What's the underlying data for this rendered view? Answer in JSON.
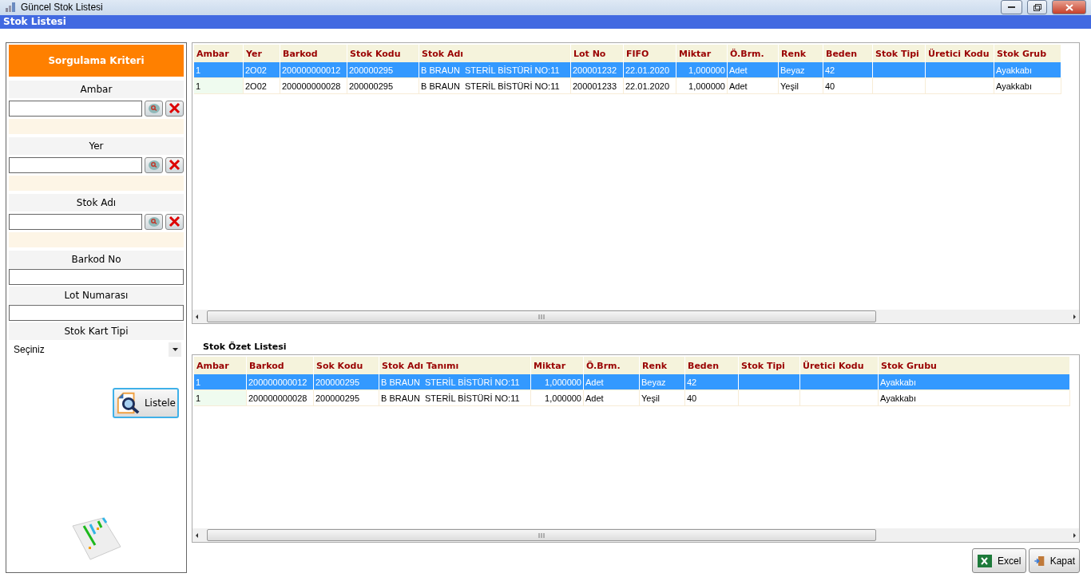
{
  "window": {
    "title": "Güncel Stok Listesi"
  },
  "header_bar": {
    "title": "Stok Listesi"
  },
  "filter_panel": {
    "title": "Sorgulama Kriteri",
    "lookups": [
      {
        "label": "Ambar"
      },
      {
        "label": "Yer"
      },
      {
        "label": "Stok Adı"
      }
    ],
    "text_fields": [
      {
        "label": "Barkod No"
      },
      {
        "label": "Lot Numarası"
      }
    ],
    "dropdown": {
      "label": "Stok Kart Tipi",
      "value": "Seçiniz"
    },
    "list_button": "Listele"
  },
  "stock_grid": {
    "columns": [
      "Ambar",
      "Yer",
      "Barkod",
      "Stok Kodu",
      "Stok Adı",
      "Lot No",
      "FIFO",
      "Miktar",
      "Ö.Brm.",
      "Renk",
      "Beden",
      "Stok Tipi",
      "Üretici Kodu",
      "Stok Grub"
    ],
    "rows": [
      {
        "selected": true,
        "cells": [
          "1",
          "2O02",
          "200000000012",
          "200000295",
          "B BRAUN  STERİL BİSTÜRİ NO:11",
          "200001232",
          "22.01.2020",
          "1,000000",
          "Adet",
          "Beyaz",
          "42",
          "",
          "",
          "Ayakkabı"
        ]
      },
      {
        "selected": false,
        "cells": [
          "1",
          "2O02",
          "200000000028",
          "200000295",
          "B BRAUN  STERİL BİSTÜRİ NO:11",
          "200001233",
          "22.01.2020",
          "1,000000",
          "Adet",
          "Yeşil",
          "40",
          "",
          "",
          "Ayakkabı"
        ]
      }
    ]
  },
  "summary_grid": {
    "title": "Stok Özet Listesi",
    "columns": [
      "Ambar",
      "Barkod",
      "Sok Kodu",
      "Stok Adı Tanımı",
      "Miktar",
      "Ö.Brm.",
      "Renk",
      "Beden",
      "Stok Tipi",
      "Üretici Kodu",
      "Stok Grubu"
    ],
    "rows": [
      {
        "selected": true,
        "cells": [
          "1",
          "200000000012",
          "200000295",
          "B BRAUN  STERİL BİSTÜRİ NO:11",
          "1,000000",
          "Adet",
          "Beyaz",
          "42",
          "",
          "",
          "Ayakkabı"
        ]
      },
      {
        "selected": false,
        "cells": [
          "1",
          "200000000028",
          "200000295",
          "B BRAUN  STERİL BİSTÜRİ NO:11",
          "1,000000",
          "Adet",
          "Yeşil",
          "40",
          "",
          "",
          "Ayakkabı"
        ]
      }
    ]
  },
  "buttons": [
    "Excel",
    "Kapat"
  ]
}
